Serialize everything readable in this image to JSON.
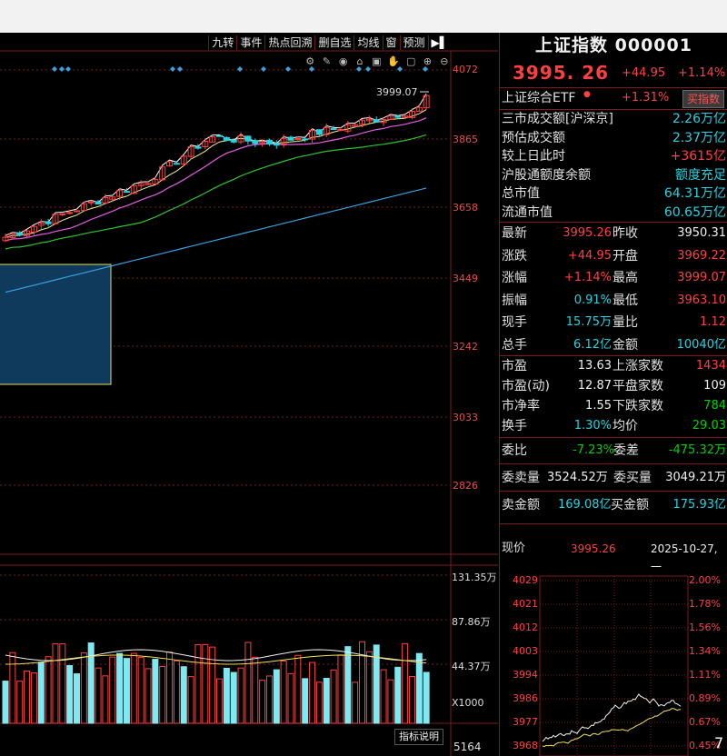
{
  "toolbar": {
    "items": [
      "九转",
      "事件",
      "热点回溯",
      "删自选",
      "均线",
      "窗",
      "预测"
    ],
    "arrow": "▶▌"
  },
  "price_axis": [
    "4072",
    "3865",
    "3658",
    "3449",
    "3242",
    "3033",
    "2826"
  ],
  "high_label": "3999.07",
  "volume_axis": [
    "131.35万",
    "87.86万",
    "44.37万"
  ],
  "volume_unit": "X1000",
  "indicator_button": "指标说明",
  "bottom_value": "5164",
  "chart_data": {
    "type": "candlestick",
    "price_axis_ticks": [
      4072,
      3865,
      3658,
      3449,
      3242,
      3033,
      2826
    ],
    "visible_high": 3999.07,
    "volume_axis_ticks_wan": [
      131.35,
      87.86,
      44.37
    ],
    "volume_unit": "X1000"
  },
  "right": {
    "title": "上证指数 000001",
    "price": "3995. 26",
    "change": "+44.95",
    "change_pct": "+1.14%",
    "etf_label": "上证综合ETF",
    "etf_pct": "+1.31%",
    "buy_button": "买指数",
    "stats_top": [
      {
        "label": "三市成交额[沪深京]",
        "value": "2.26万亿",
        "color": "cyan"
      },
      {
        "label": "预估成交额",
        "value": "2.37万亿",
        "color": "cyan"
      },
      {
        "label": "较上日此时",
        "value": "+3615亿",
        "color": "red"
      },
      {
        "label": "沪股通额度余额",
        "value": "额度充足",
        "color": "cyan"
      },
      {
        "label": "总市值",
        "value": "64.31万亿",
        "color": "cyan"
      },
      {
        "label": "流通市值",
        "value": "60.65万亿",
        "color": "cyan"
      }
    ],
    "quote_rows": [
      {
        "l1": "最新",
        "v1": "3995.26",
        "c1": "red",
        "l2": "昨收",
        "v2": "3950.31",
        "c2": "white"
      },
      {
        "l1": "涨跌",
        "v1": "+44.95",
        "c1": "red",
        "l2": "开盘",
        "v2": "3969.22",
        "c2": "red"
      },
      {
        "l1": "涨幅",
        "v1": "+1.14%",
        "c1": "red",
        "l2": "最高",
        "v2": "3999.07",
        "c2": "red"
      },
      {
        "l1": "振幅",
        "v1": "0.91%",
        "c1": "cyan",
        "l2": "最低",
        "v2": "3963.10",
        "c2": "red"
      },
      {
        "l1": "现手",
        "v1": "15.75万",
        "c1": "cyan",
        "l2": "量比",
        "v2": "1.12",
        "c2": "red"
      },
      {
        "l1": "总手",
        "v1": "6.12亿",
        "c1": "cyan",
        "l2": "金额",
        "v2": "10040亿",
        "c2": "cyan"
      }
    ],
    "market_rows": [
      {
        "l1": "市盈",
        "v1": "13.63",
        "c1": "white",
        "l2": "上涨家数",
        "v2": "1434",
        "c2": "red"
      },
      {
        "l1": "市盈(动)",
        "v1": "12.87",
        "c1": "white",
        "l2": "平盘家数",
        "v2": "109",
        "c2": "white"
      },
      {
        "l1": "市净率",
        "v1": "1.55",
        "c1": "white",
        "l2": "下跌家数",
        "v2": "784",
        "c2": "green"
      },
      {
        "l1": "换手",
        "v1": "1.30%",
        "c1": "cyan",
        "l2": "均价",
        "v2": "29.03",
        "c2": "green"
      }
    ],
    "weibi": {
      "label": "委比",
      "value": "-7.23%",
      "label2": "委差",
      "value2": "-475.32万"
    },
    "weimai": {
      "label": "委卖量",
      "value": "3524.52万",
      "label2": "委买量",
      "value2": "3049.21万"
    },
    "maijin": {
      "label": "卖金额",
      "value": "169.08亿",
      "label2": "买金额",
      "value2": "175.93亿"
    },
    "xianjia": {
      "label": "现价",
      "value": "3995.26",
      "date": "2025-10-27,一"
    },
    "mini_left": [
      "4029",
      "4021",
      "4012",
      "4003",
      "3994",
      "3986",
      "3977",
      "3968"
    ],
    "mini_right": [
      "2.00%",
      "1.78%",
      "1.56%",
      "1.34%",
      "1.11%",
      "0.89%",
      "0.67%",
      "0.45%"
    ],
    "corner_digit": "7"
  },
  "colors": {
    "up": "#ff4040",
    "down": "#25d2e0",
    "bg": "#000000",
    "grid": "#7a1c1c"
  }
}
